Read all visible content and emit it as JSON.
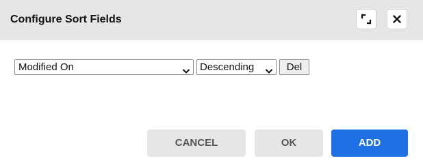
{
  "dialog": {
    "title": "Configure Sort Fields",
    "expand_icon": "expand-icon",
    "close_icon": "close-icon"
  },
  "sort_rows": [
    {
      "field": {
        "selected": "Modified On"
      },
      "order": {
        "selected": "Descending"
      },
      "delete_label": "Del"
    }
  ],
  "footer": {
    "cancel_label": "CANCEL",
    "ok_label": "OK",
    "add_label": "ADD"
  },
  "colors": {
    "header_bg": "#e6e6e6",
    "primary": "#1f6fe5",
    "secondary_bg": "#e6e6e6",
    "secondary_text": "#555555"
  }
}
